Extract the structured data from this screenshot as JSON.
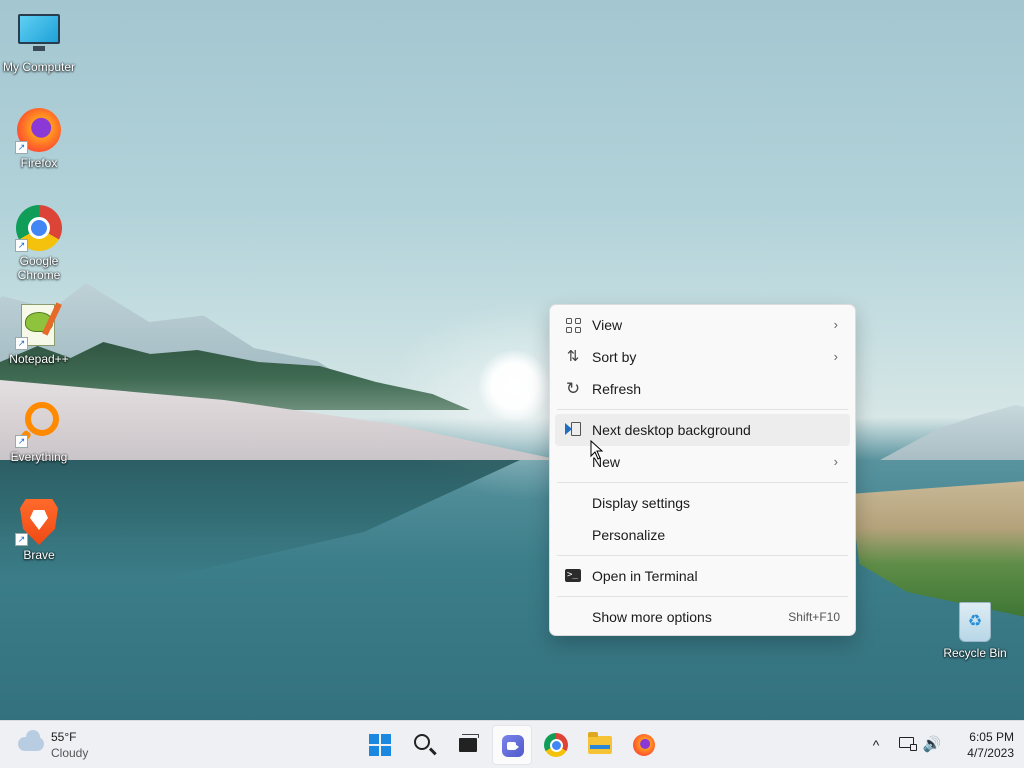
{
  "desktop": {
    "icons": [
      {
        "label": "My Computer",
        "icon": "monitor-icon"
      },
      {
        "label": "Firefox",
        "icon": "firefox-icon"
      },
      {
        "label": "Google Chrome",
        "icon": "chrome-icon"
      },
      {
        "label": "Notepad++",
        "icon": "notepad-plus-plus-icon"
      },
      {
        "label": "Everything",
        "icon": "everything-search-icon"
      },
      {
        "label": "Brave",
        "icon": "brave-icon"
      },
      {
        "label": "Recycle Bin",
        "icon": "recycle-bin-icon"
      }
    ],
    "shortcut_arrow": "↗"
  },
  "context_menu": {
    "items": [
      {
        "label": "View",
        "icon": "grid-view-icon",
        "submenu": true
      },
      {
        "label": "Sort by",
        "icon": "sort-arrows-icon",
        "submenu": true
      },
      {
        "label": "Refresh",
        "icon": "refresh-icon",
        "submenu": false
      },
      {
        "label": "Next desktop background",
        "icon": "next-background-icon",
        "submenu": false,
        "highlighted": true
      },
      {
        "label": "New",
        "icon": "",
        "submenu": true
      },
      {
        "label": "Display settings",
        "icon": "",
        "submenu": false
      },
      {
        "label": "Personalize",
        "icon": "",
        "submenu": false
      },
      {
        "label": "Open in Terminal",
        "icon": "terminal-icon",
        "submenu": false
      },
      {
        "label": "Show more options",
        "icon": "",
        "submenu": false,
        "shortcut": "Shift+F10"
      }
    ],
    "chevron": "›",
    "sort_glyph": "⇅",
    "refresh_glyph": "↻",
    "terminal_glyph": ">_"
  },
  "taskbar": {
    "weather": {
      "temp": "55°F",
      "condition": "Cloudy",
      "icon": "cloud-icon"
    },
    "apps": [
      {
        "name": "start",
        "icon": "windows-start-icon",
        "active": false
      },
      {
        "name": "search",
        "icon": "search-icon",
        "active": false
      },
      {
        "name": "task-view",
        "icon": "task-view-icon",
        "active": false
      },
      {
        "name": "teams-chat",
        "icon": "teams-chat-icon",
        "active": true
      },
      {
        "name": "chrome",
        "icon": "chrome-icon",
        "active": false
      },
      {
        "name": "file-explorer",
        "icon": "file-explorer-icon",
        "active": false
      },
      {
        "name": "firefox",
        "icon": "firefox-icon",
        "active": false
      }
    ],
    "tray": {
      "chevron": "^",
      "volume_glyph": "🔊"
    },
    "clock": {
      "time": "6:05 PM",
      "date": "4/7/2023"
    }
  },
  "colors": {
    "accent": "#1a88e0",
    "menu_bg": "#f9f9f9",
    "taskbar_bg": "#eef0f3"
  }
}
